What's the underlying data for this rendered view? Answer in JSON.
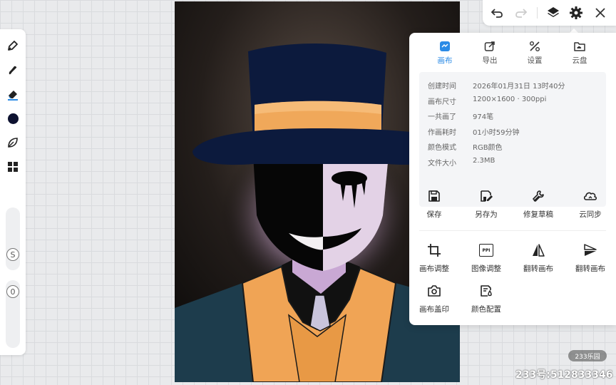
{
  "left_toolbar": {
    "tools": [
      {
        "name": "pen-icon"
      },
      {
        "name": "smudge-icon"
      },
      {
        "name": "eraser-icon"
      },
      {
        "name": "color-swatch-icon",
        "color": "#0d1230"
      },
      {
        "name": "leaf-icon"
      },
      {
        "name": "layout-grid-icon"
      }
    ],
    "size_slider_label": "S",
    "opacity_slider_label": "0"
  },
  "top_bar": {
    "icons": [
      "undo-icon",
      "redo-icon",
      "layers-icon",
      "gear-icon",
      "close-icon"
    ]
  },
  "settings_panel": {
    "tabs": [
      {
        "label": "画布",
        "icon": "canvas-icon",
        "active": true
      },
      {
        "label": "导出",
        "icon": "export-icon",
        "active": false
      },
      {
        "label": "设置",
        "icon": "settings-tools-icon",
        "active": false
      },
      {
        "label": "云盘",
        "icon": "cloud-folder-icon",
        "active": false
      }
    ],
    "info": [
      {
        "key": "创建时间",
        "value": "2026年01月31日 13时40分"
      },
      {
        "key": "画布尺寸",
        "value": "1200×1600 · 300ppi"
      },
      {
        "key": "一共画了",
        "value": "974笔"
      },
      {
        "key": "作画耗时",
        "value": "01小时59分钟"
      },
      {
        "key": "颜色模式",
        "value": "RGB颜色"
      },
      {
        "key": "文件大小",
        "value": "2.3MB"
      }
    ],
    "actions_row1": [
      {
        "label": "保存",
        "icon": "save-icon"
      },
      {
        "label": "另存为",
        "icon": "save-as-icon"
      },
      {
        "label": "修复草稿",
        "icon": "wrench-icon"
      },
      {
        "label": "云同步",
        "icon": "cloud-sync-icon"
      }
    ],
    "actions_row2": [
      {
        "label": "画布调整",
        "icon": "crop-icon"
      },
      {
        "label": "图像调整",
        "icon": "ppi-icon",
        "icon_text": "PPI"
      },
      {
        "label": "翻转画布",
        "icon": "flip-horizontal-icon"
      },
      {
        "label": "翻转画布",
        "icon": "flip-vertical-icon"
      }
    ],
    "actions_row3": [
      {
        "label": "画布盖印",
        "icon": "camera-icon"
      },
      {
        "label": "颜色配置",
        "icon": "color-config-icon"
      }
    ]
  },
  "colors": {
    "accent": "#2b8be6",
    "hat": "#0c1a3d",
    "hat_band": "#f0a85a",
    "mask_white": "#f3f0f2",
    "mask_black": "#060606",
    "glow": "#c9a6cf",
    "jacket": "#1d3c4c",
    "cravat": "#f0a455"
  },
  "watermark": {
    "logo": "233乐园",
    "text": "233号:512833346"
  }
}
